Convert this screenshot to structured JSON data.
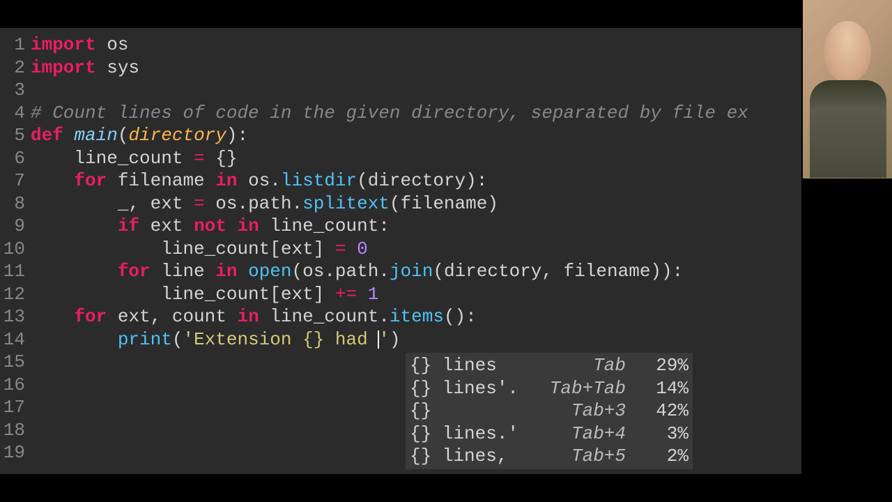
{
  "editor": {
    "lines": [
      {
        "n": 1,
        "tokens": [
          [
            "kw",
            "import"
          ],
          [
            "id",
            " os"
          ]
        ]
      },
      {
        "n": 2,
        "tokens": [
          [
            "kw",
            "import"
          ],
          [
            "id",
            " sys"
          ]
        ]
      },
      {
        "n": 3,
        "tokens": [
          [
            "id",
            ""
          ]
        ]
      },
      {
        "n": 4,
        "tokens": [
          [
            "comment",
            "# Count lines of code in the given directory, separated by file ex"
          ]
        ]
      },
      {
        "n": 5,
        "tokens": [
          [
            "kw",
            "def "
          ],
          [
            "fnname",
            "main"
          ],
          [
            "id",
            "("
          ],
          [
            "param",
            "directory"
          ],
          [
            "id",
            "):"
          ]
        ]
      },
      {
        "n": 6,
        "tokens": [
          [
            "id",
            "    line_count "
          ],
          [
            "op",
            "="
          ],
          [
            "id",
            " {}"
          ]
        ]
      },
      {
        "n": 7,
        "tokens": [
          [
            "id",
            "    "
          ],
          [
            "kw",
            "for"
          ],
          [
            "id",
            " filename "
          ],
          [
            "kw",
            "in"
          ],
          [
            "id",
            " os."
          ],
          [
            "call",
            "listdir"
          ],
          [
            "id",
            "(directory):"
          ]
        ]
      },
      {
        "n": 8,
        "tokens": [
          [
            "id",
            "        _, ext "
          ],
          [
            "op",
            "="
          ],
          [
            "id",
            " os.path."
          ],
          [
            "call",
            "splitext"
          ],
          [
            "id",
            "(filename)"
          ]
        ]
      },
      {
        "n": 9,
        "tokens": [
          [
            "id",
            "        "
          ],
          [
            "kw",
            "if"
          ],
          [
            "id",
            " ext "
          ],
          [
            "kw",
            "not in"
          ],
          [
            "id",
            " line_count:"
          ]
        ]
      },
      {
        "n": 10,
        "tokens": [
          [
            "id",
            "            line_count[ext] "
          ],
          [
            "op",
            "="
          ],
          [
            "id",
            " "
          ],
          [
            "num",
            "0"
          ]
        ]
      },
      {
        "n": 11,
        "tokens": [
          [
            "id",
            "        "
          ],
          [
            "kw",
            "for"
          ],
          [
            "id",
            " line "
          ],
          [
            "kw",
            "in"
          ],
          [
            "id",
            " "
          ],
          [
            "call",
            "open"
          ],
          [
            "id",
            "(os.path."
          ],
          [
            "call",
            "join"
          ],
          [
            "id",
            "(directory, filename)):"
          ]
        ]
      },
      {
        "n": 12,
        "tokens": [
          [
            "id",
            "            line_count[ext] "
          ],
          [
            "op",
            "+="
          ],
          [
            "id",
            " "
          ],
          [
            "num",
            "1"
          ]
        ]
      },
      {
        "n": 13,
        "tokens": [
          [
            "id",
            "    "
          ],
          [
            "kw",
            "for"
          ],
          [
            "id",
            " ext, count "
          ],
          [
            "kw",
            "in"
          ],
          [
            "id",
            " line_count."
          ],
          [
            "call",
            "items"
          ],
          [
            "id",
            "():"
          ]
        ]
      },
      {
        "n": 14,
        "tokens": [
          [
            "id",
            "        "
          ],
          [
            "call",
            "print"
          ],
          [
            "id",
            "("
          ],
          [
            "str",
            "'Extension {} had |'"
          ],
          [
            "id",
            ")"
          ]
        ]
      },
      {
        "n": 15,
        "tokens": [
          [
            "id",
            ""
          ]
        ]
      },
      {
        "n": 16,
        "tokens": [
          [
            "id",
            ""
          ]
        ]
      },
      {
        "n": 17,
        "tokens": [
          [
            "id",
            ""
          ]
        ]
      },
      {
        "n": 18,
        "tokens": [
          [
            "id",
            ""
          ]
        ]
      },
      {
        "n": 19,
        "tokens": [
          [
            "id",
            ""
          ]
        ]
      }
    ]
  },
  "completions": [
    {
      "text": "{} lines",
      "key": "Tab",
      "pct": "29%"
    },
    {
      "text": "{} lines'.",
      "key": "Tab+Tab",
      "pct": "14%"
    },
    {
      "text": "{}",
      "key": "Tab+3",
      "pct": "42%"
    },
    {
      "text": "{} lines.'",
      "key": "Tab+4",
      "pct": "3%"
    },
    {
      "text": "{} lines,",
      "key": "Tab+5",
      "pct": "2%"
    }
  ]
}
